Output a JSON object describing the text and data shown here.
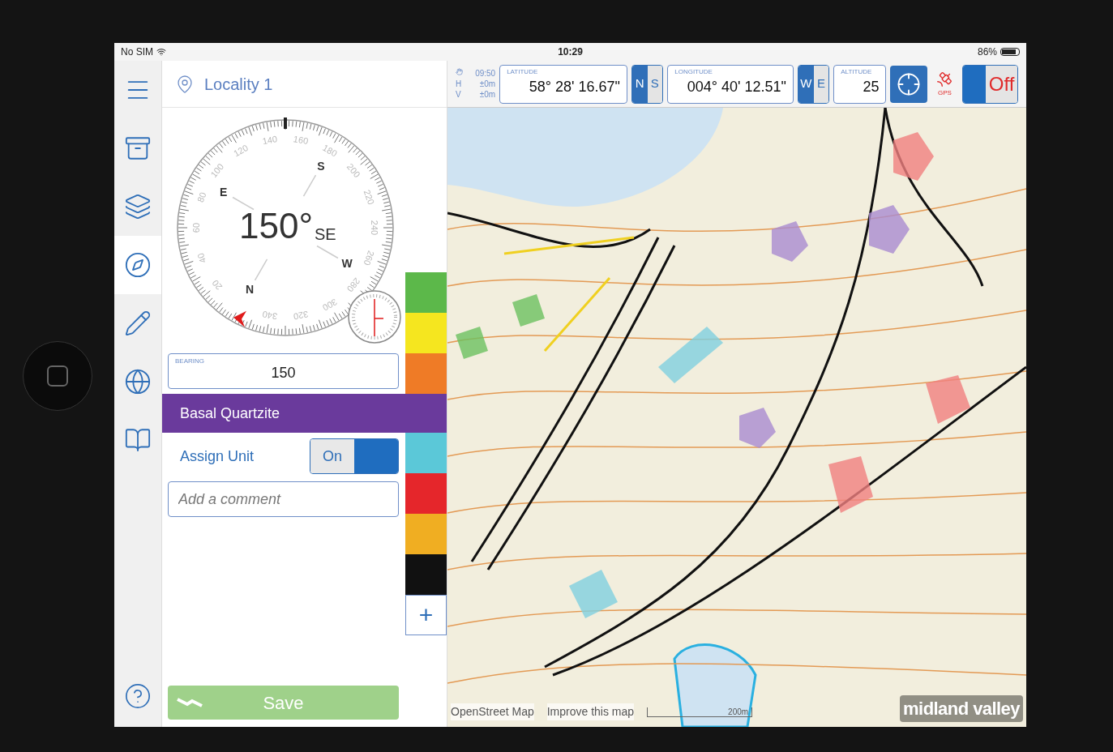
{
  "status_bar": {
    "carrier": "No SIM",
    "time": "10:29",
    "battery": "86%"
  },
  "rail": [
    {
      "kind": "menu",
      "selected": false
    },
    {
      "kind": "archive",
      "selected": false
    },
    {
      "kind": "layers",
      "selected": false
    },
    {
      "kind": "compass",
      "selected": true
    },
    {
      "kind": "pencil",
      "selected": false
    },
    {
      "kind": "globe",
      "selected": false
    },
    {
      "kind": "book",
      "selected": false
    }
  ],
  "locality": "Locality 1",
  "compass": {
    "heading": "150°",
    "direction": "SE",
    "dial_labels": [
      "20",
      "40",
      "60",
      "80",
      "100",
      "120",
      "140",
      "160",
      "180",
      "200",
      "220",
      "240",
      "260",
      "280",
      "300",
      "320",
      "340"
    ],
    "cardinals": [
      "N",
      "E",
      "S",
      "W"
    ]
  },
  "bearing": {
    "label": "BEARING",
    "value": "150"
  },
  "swatches_above": [
    {
      "color": "#5cb84a"
    },
    {
      "color": "#f5e61f"
    },
    {
      "color": "#ef7b26"
    }
  ],
  "unit": {
    "name": "Basal Quartzite",
    "color": "#6a3a9c"
  },
  "swatches_below": [
    {
      "color": "#5bc8d8"
    },
    {
      "color": "#e5262b"
    },
    {
      "color": "#f0ae22"
    },
    {
      "color": "#111111"
    }
  ],
  "add_swatch": "+",
  "assign_unit": {
    "label": "Assign Unit",
    "toggle_label": "On",
    "on": true
  },
  "comment": {
    "placeholder": "Add a comment"
  },
  "save": {
    "label": "Save",
    "disabled": true
  },
  "gps": {
    "time": "09:50",
    "h_label": "H",
    "h_value": "±0m",
    "v_label": "V",
    "v_value": "±0m"
  },
  "latitude": {
    "label": "LATITUDE",
    "value": "58° 28' 16.67\"",
    "hemis": [
      {
        "label": "N",
        "selected": true
      },
      {
        "label": "S",
        "selected": false
      }
    ]
  },
  "longitude": {
    "label": "LONGITUDE",
    "value": "004° 40' 12.51\"",
    "hemis": [
      {
        "label": "W",
        "selected": true
      },
      {
        "label": "E",
        "selected": false
      }
    ]
  },
  "altitude": {
    "label": "ALTITUDE",
    "value": "25"
  },
  "gps_label": "GPS",
  "gps_toggle": {
    "label": "Off",
    "on": false
  },
  "map_footer": {
    "attribution": "OpenStreet Map",
    "improve_link": "Improve this map",
    "scale": "200m",
    "logo": "midland valley"
  }
}
